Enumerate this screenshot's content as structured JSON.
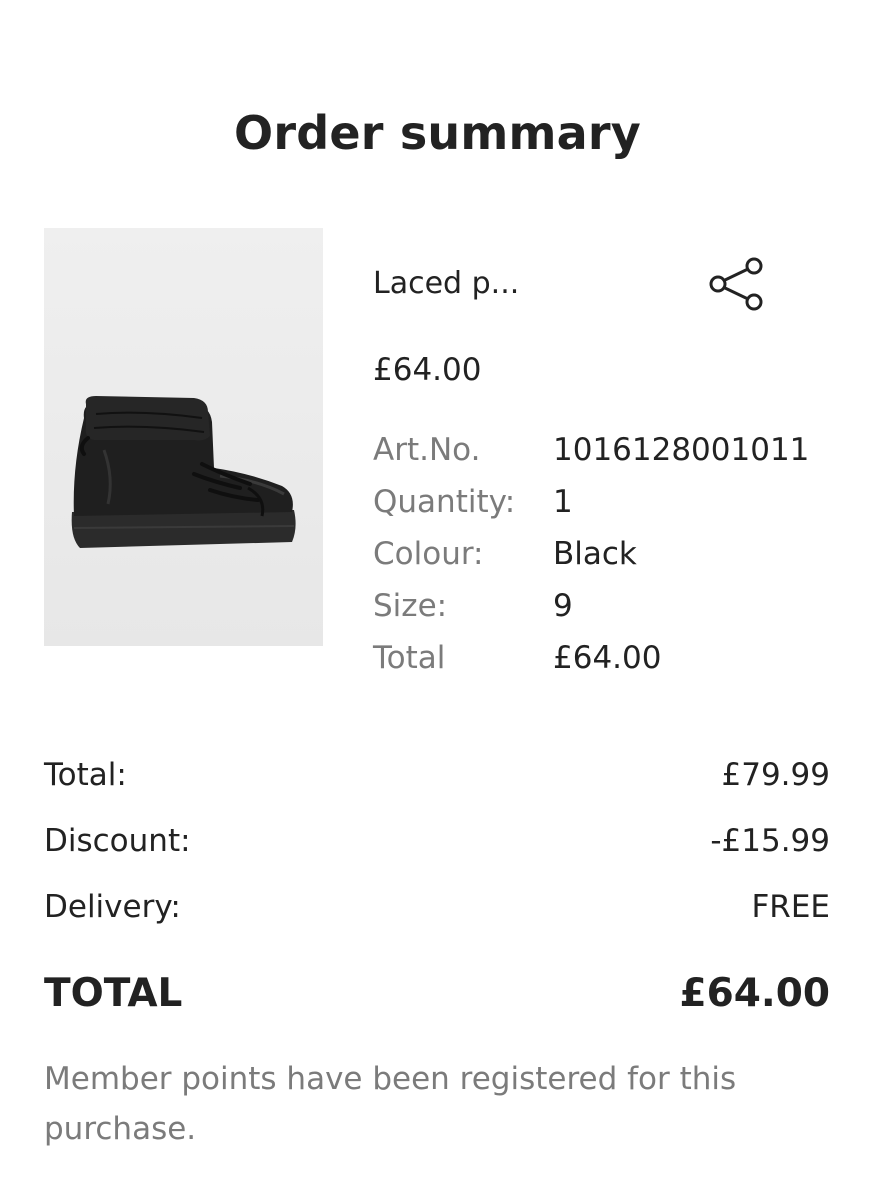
{
  "page": {
    "title": "Order summary"
  },
  "product": {
    "name": "Laced p...",
    "price": "£64.00",
    "image_description": "black padded lace-up ankle boot",
    "share_icon": "share-icon",
    "attributes": [
      {
        "label": "Art.No.",
        "value": "1016128001011"
      },
      {
        "label": "Quantity:",
        "value": "1"
      },
      {
        "label": "Colour:",
        "value": "Black"
      },
      {
        "label": "Size:",
        "value": "9"
      },
      {
        "label": "Total",
        "value": "£64.00"
      }
    ]
  },
  "summary": {
    "rows": [
      {
        "label": "Total:",
        "value": "£79.99"
      },
      {
        "label": "Discount:",
        "value": "-£15.99"
      },
      {
        "label": "Delivery:",
        "value": "FREE"
      }
    ],
    "grand_total": {
      "label": "TOTAL",
      "value": "£64.00"
    },
    "note": "Member points have been registered for this purchase."
  },
  "colors": {
    "text_primary": "#222222",
    "text_secondary": "#7b7b7b",
    "image_background": "#ededed"
  }
}
